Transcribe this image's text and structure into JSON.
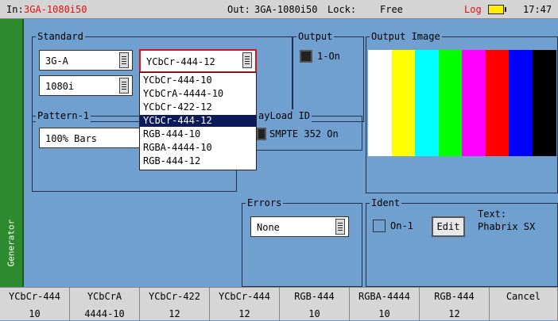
{
  "status": {
    "in_label": "In:",
    "in_value": "3GA-1080i50",
    "out_label": "Out:",
    "out_value": "3GA-1080i50",
    "lock_label": "Lock:",
    "lock_value": "Free",
    "log_label": "Log",
    "time": "17:47"
  },
  "sidebar": {
    "label": "Generator"
  },
  "standard": {
    "title": "Standard",
    "level": "3G-A",
    "format": "1080i",
    "colour_space": "YCbCr-444-12"
  },
  "dropdown": {
    "items": [
      "YCbCr-444-10",
      "YCbCrA-4444-10",
      "YCbCr-422-12",
      "YCbCr-444-12",
      "RGB-444-10",
      "RGBA-4444-10",
      "RGB-444-12"
    ],
    "selected_index": 3
  },
  "output": {
    "title": "Output",
    "toggle_label": "1-On",
    "checked": true
  },
  "output_image": {
    "title": "Output Image",
    "bar_colors": [
      "#ffffff",
      "#ffff00",
      "#00ffff",
      "#00ff00",
      "#ff00ff",
      "#ff0000",
      "#0000ff",
      "#000000"
    ]
  },
  "pattern": {
    "title": "Pattern-1",
    "value": "100% Bars"
  },
  "payload": {
    "title": "PayLoad ID",
    "title_visible": "ayLoad ID",
    "toggle_label": "SMPTE 352 On",
    "checked": true
  },
  "errors": {
    "title": "Errors",
    "value": "None"
  },
  "ident": {
    "title": "Ident",
    "toggle_label": "On-1",
    "checked": false,
    "edit_label": "Edit",
    "text_label": "Text:",
    "text_value": "Phabrix SX"
  },
  "softkeys": [
    {
      "line1": "YCbCr-444",
      "line2": "10"
    },
    {
      "line1": "YCbCrA",
      "line2": "4444-10"
    },
    {
      "line1": "YCbCr-422",
      "line2": "12"
    },
    {
      "line1": "YCbCr-444",
      "line2": "12"
    },
    {
      "line1": "RGB-444",
      "line2": "10"
    },
    {
      "line1": "RGBA-4444",
      "line2": "10"
    },
    {
      "line1": "RGB-444",
      "line2": "12"
    },
    {
      "line1": "Cancel",
      "line2": ""
    }
  ],
  "colors": {
    "background": "#6fa0d0",
    "sidebar": "#2e8a2e",
    "highlight": "#0c1a5c",
    "alert": "#e01010",
    "battery": "#ffee00"
  }
}
